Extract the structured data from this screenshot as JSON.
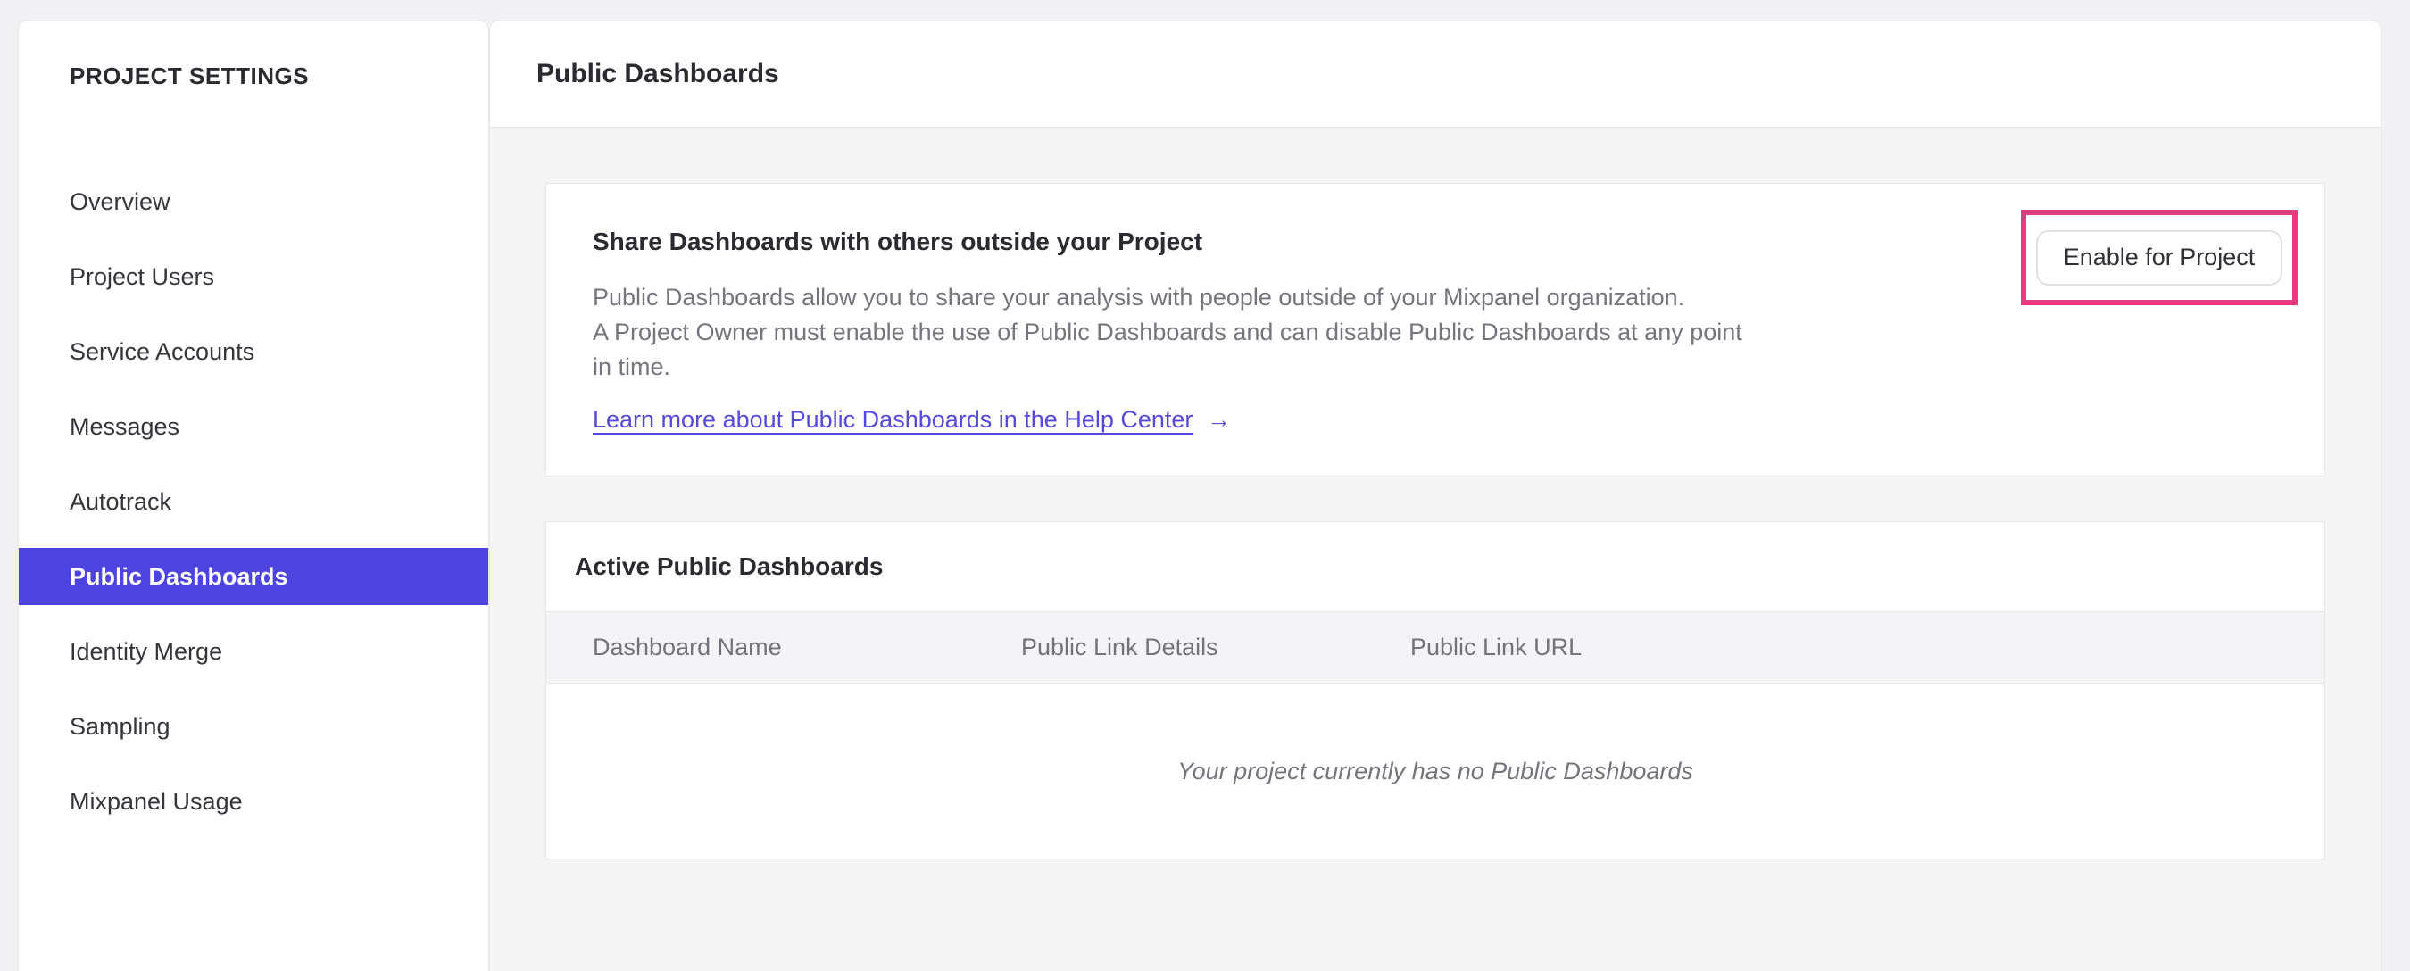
{
  "sidebar": {
    "title": "PROJECT SETTINGS",
    "items": [
      {
        "label": "Overview",
        "selected": false
      },
      {
        "label": "Project Users",
        "selected": false
      },
      {
        "label": "Service Accounts",
        "selected": false
      },
      {
        "label": "Messages",
        "selected": false
      },
      {
        "label": "Autotrack",
        "selected": false
      },
      {
        "label": "Public Dashboards",
        "selected": true
      },
      {
        "label": "Identity Merge",
        "selected": false
      },
      {
        "label": "Sampling",
        "selected": false
      },
      {
        "label": "Mixpanel Usage",
        "selected": false
      }
    ]
  },
  "header": {
    "title": "Public Dashboards"
  },
  "share_card": {
    "heading": "Share Dashboards with others outside your Project",
    "body_lines": [
      "Public Dashboards allow you to share your analysis with people outside of your Mixpanel organization.",
      "A Project Owner must enable the use of Public Dashboards and can disable Public Dashboards at any point",
      "in time."
    ],
    "link_label": "Learn more about Public Dashboards in the Help Center",
    "link_arrow": "→",
    "enable_button_label": "Enable for Project"
  },
  "active_card": {
    "heading": "Active Public Dashboards",
    "columns": [
      "Dashboard Name",
      "Public Link Details",
      "Public Link URL"
    ],
    "empty_message": "Your project currently has no Public Dashboards"
  },
  "colors": {
    "accent_purple": "#4d44e0",
    "link_purple": "#554bdb",
    "highlight_pink": "#e23c7e"
  }
}
